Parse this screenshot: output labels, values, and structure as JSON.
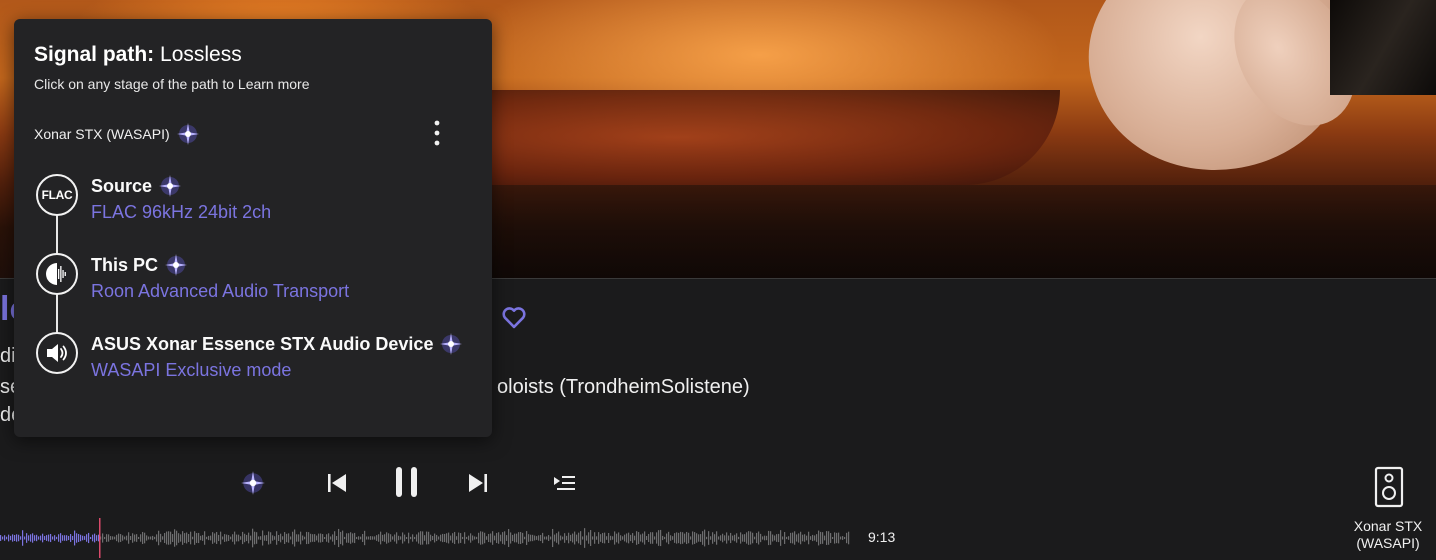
{
  "colors": {
    "accent": "#7b74e0",
    "popup_bg": "#232325",
    "page_bg": "#1b1b1c",
    "sparkle": "#8f86ff",
    "playhead": "#d94a6a"
  },
  "track": {
    "title_fragment": "lo",
    "line2_fragment": "di",
    "line3_fragment": "se",
    "line4_fragment": "de",
    "performer_fragment": "oloists (TrondheimSolistene)",
    "favorite_icon": "heart-icon"
  },
  "signal_path": {
    "title_label": "Signal path:",
    "quality": "Lossless",
    "subtitle": "Click on any stage of the path to Learn more",
    "zone": "Xonar STX (WASAPI)",
    "stages": [
      {
        "name": "Source",
        "detail": "FLAC 96kHz 24bit 2ch",
        "icon_text": "FLAC",
        "icon": "flac-icon"
      },
      {
        "name": "This PC",
        "detail": "Roon Advanced Audio Transport",
        "icon": "roon-transport-icon"
      },
      {
        "name": "ASUS Xonar Essence STX Audio Device",
        "detail": "WASAPI Exclusive mode",
        "icon": "speaker-volume-icon"
      }
    ]
  },
  "transport": {
    "total_time": "9:13",
    "progress": 0.117
  },
  "zone_selector": {
    "label": "Xonar STX (WASAPI)",
    "icon": "speaker-device-icon"
  }
}
